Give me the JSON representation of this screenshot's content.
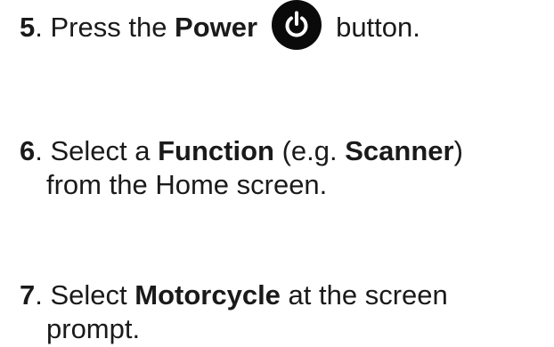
{
  "steps": [
    {
      "number": "5",
      "sep": ". ",
      "t1": "Press the ",
      "b1": "Power",
      "icon": "power-icon",
      "t2": "button."
    },
    {
      "number": "6",
      "sep": ". ",
      "t1": "Select a ",
      "b1": "Function",
      "t2": " (e.g. ",
      "b2": "Scanner",
      "t3": ")",
      "line2": "from the Home screen."
    },
    {
      "number": "7",
      "sep": ". ",
      "t1": "Select ",
      "b1": "Motorcycle",
      "t2": " at the screen",
      "line2": "prompt."
    }
  ]
}
